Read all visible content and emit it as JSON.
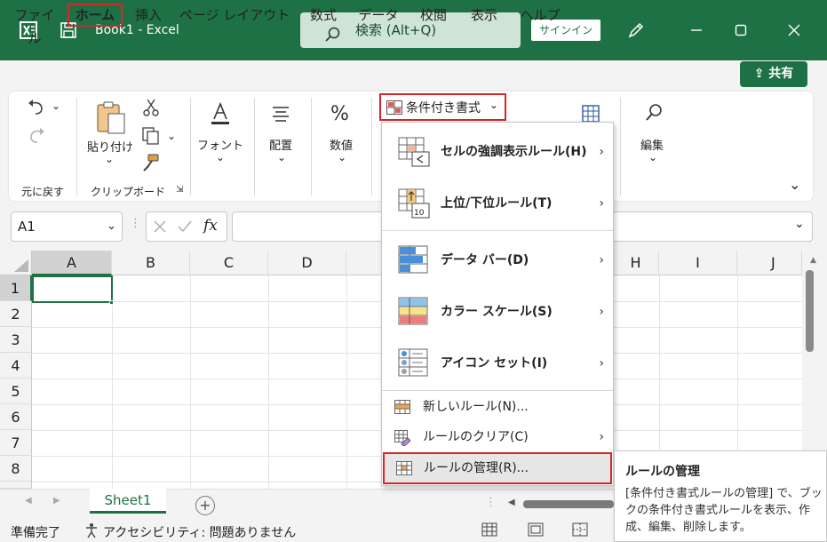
{
  "titlebar": {
    "doc_title": "Book1 - Excel",
    "search_label": "検索 (Alt+Q)",
    "signin_label": "サインイン"
  },
  "menu": {
    "items": [
      "ファイル",
      "ホーム",
      "挿入",
      "ページ レイアウト",
      "数式",
      "データ",
      "校閲",
      "表示",
      "ヘルプ"
    ],
    "share_label": "共有"
  },
  "ribbon": {
    "undo_group": "元に戻す",
    "clipboard": {
      "paste": "貼り付け",
      "group": "クリップボード"
    },
    "font": "フォント",
    "alignment": "配置",
    "number": "数値",
    "conditional_formatting": "条件付き書式",
    "editing": "編集"
  },
  "formula_bar": {
    "name_box": "A1",
    "fx": "fx"
  },
  "grid": {
    "columns": [
      "A",
      "B",
      "C",
      "D",
      "H",
      "I",
      "J"
    ],
    "rows": [
      "1",
      "2",
      "3",
      "4",
      "5",
      "6",
      "7",
      "8"
    ]
  },
  "dropdown": {
    "big_items": [
      "セルの強調表示ルール(H)",
      "上位/下位ルール(T)",
      "データ バー(D)",
      "カラー スケール(S)",
      "アイコン セット(I)"
    ],
    "small_items": [
      "新しいルール(N)...",
      "ルールのクリア(C)",
      "ルールの管理(R)..."
    ],
    "top_bottom_icon_text": "10"
  },
  "tooltip": {
    "title": "ルールの管理",
    "body": "[条件付き書式ルールの管理] で、ブックの条件付き書式ルールを表示、作成、編集、削除します。"
  },
  "sheets": {
    "active": "Sheet1"
  },
  "status": {
    "ready": "準備完了",
    "accessibility": "アクセシビリティ: 問題ありません"
  },
  "colors": {
    "accent": "#1e7145",
    "highlight_border": "#d6262b"
  }
}
